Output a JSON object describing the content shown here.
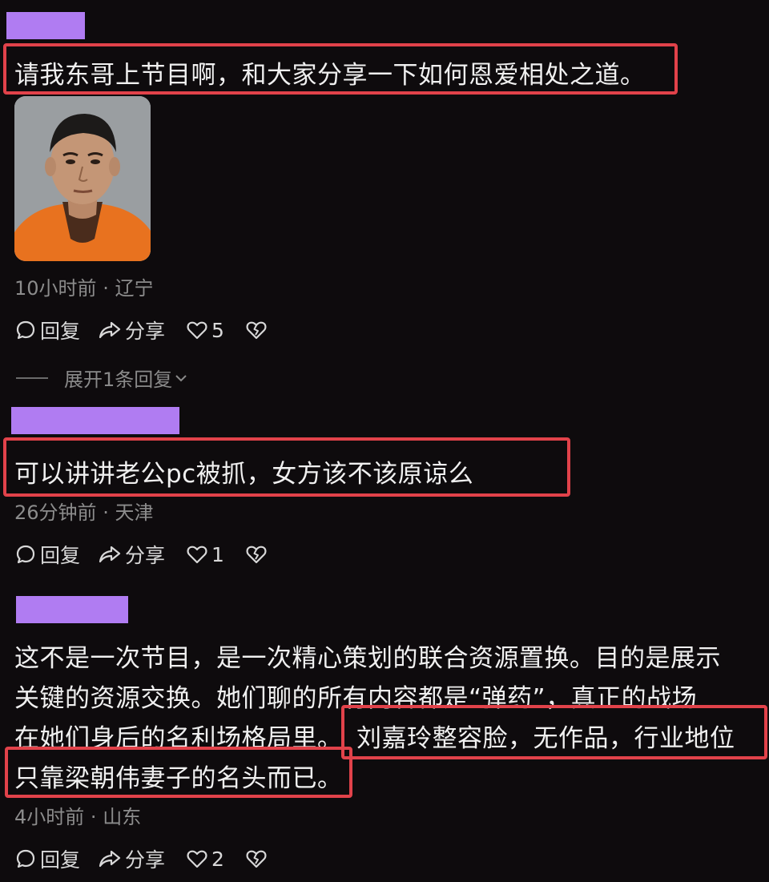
{
  "comments": [
    {
      "text": "请我东哥上节目啊，和大家分享一下如何恩爱相处之道。",
      "time": "10小时前",
      "region": "辽宁",
      "reply_label": "回复",
      "share_label": "分享",
      "likes": "5",
      "expand_label": "展开1条回复"
    },
    {
      "text": "可以讲讲老公pc被抓，女方该不该原谅么",
      "time": "26分钟前",
      "region": "天津",
      "reply_label": "回复",
      "share_label": "分享",
      "likes": "1"
    },
    {
      "lines": [
        "这不是一次节目，是一次精心策划的联合资源置换。目的是展示",
        "关键的资源交换。她们聊的所有内容都是“弹药”，真正的战场",
        "在她们身后的名利场格局里。",
        "刘嘉玲整容脸，无作品，行业地位",
        "只靠梁朝伟妻子的名头而已。"
      ],
      "time": "4小时前",
      "region": "山东",
      "reply_label": "回复",
      "share_label": "分享",
      "likes": "2"
    }
  ],
  "separator": "·",
  "colors": {
    "background": "#0e0b0d",
    "name_redaction": "#b07cf2",
    "highlight_box": "#e1424a",
    "meta_text": "#8c8c8c"
  },
  "icons": [
    "comment-icon",
    "share-icon",
    "heart-icon",
    "dislike-icon",
    "chevron-down-icon"
  ]
}
